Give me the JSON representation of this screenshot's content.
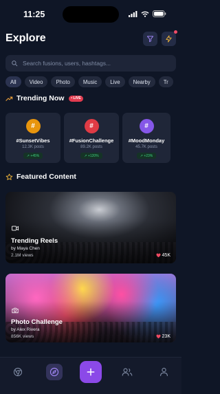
{
  "status": {
    "time": "11:25"
  },
  "header": {
    "title": "Explore",
    "filter_icon": "filter-icon",
    "activity_icon": "lightning-icon"
  },
  "search": {
    "placeholder": "Search fusions, users, hashtags..."
  },
  "chips": [
    "All",
    "Video",
    "Photo",
    "Music",
    "Live",
    "Nearby",
    "Tr"
  ],
  "trending": {
    "title": "Trending Now",
    "live_badge": "• LIVE",
    "items": [
      {
        "tag": "#SunsetVibes",
        "posts": "12.3K posts",
        "growth": "↗ +45%",
        "color": "#e8950d"
      },
      {
        "tag": "#FusionChallenge",
        "posts": "89.2K posts",
        "growth": "↗ +120%",
        "color": "#df3b45"
      },
      {
        "tag": "#MoodMonday",
        "posts": "45.7K posts",
        "growth": "↗ +23%",
        "color": "#8557e8"
      }
    ]
  },
  "featured": {
    "title": "Featured Content",
    "items": [
      {
        "title": "Trending Reels",
        "by": "by Maya Chen",
        "views": "2.1M views",
        "likes": "45K"
      },
      {
        "title": "Photo Challenge",
        "by": "by Alex Rivera",
        "views": "856K views",
        "likes": "23K"
      }
    ]
  },
  "colors": {
    "accent": "#8b49e8",
    "background": "#0f1626",
    "card": "#1f2638",
    "like": "#f04a62",
    "growth": "#3ed17f"
  }
}
